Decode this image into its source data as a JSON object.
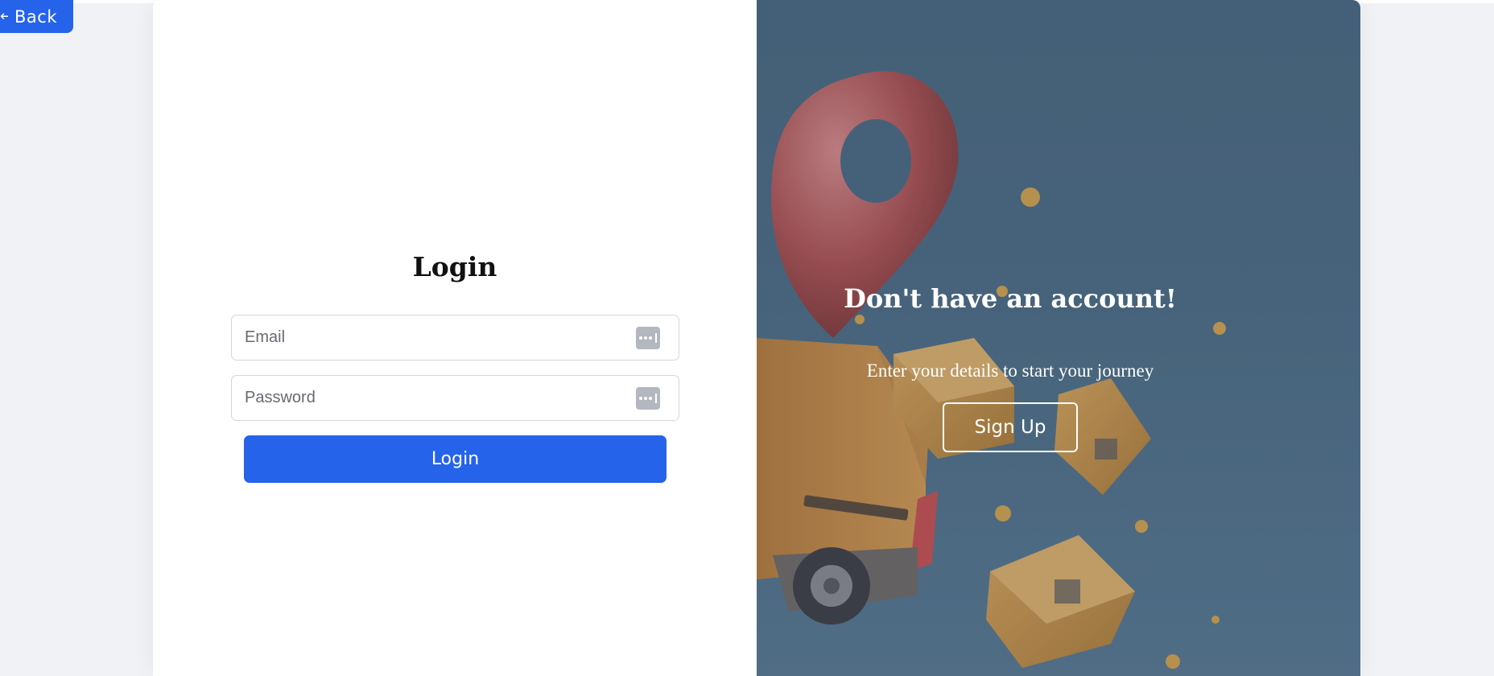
{
  "nav": {
    "back_label": "Back",
    "back_icon": "arrow-left-icon"
  },
  "login": {
    "title": "Login",
    "email_placeholder": "Email",
    "password_placeholder": "Password",
    "field_icon": "password-manager-icon",
    "submit_label": "Login"
  },
  "signup_panel": {
    "title": "Don't have an account!",
    "subtitle": "Enter your details to start your journey",
    "button_label": "Sign Up"
  },
  "colors": {
    "accent": "#2563eb",
    "panel_background": "#4d6c84",
    "page_background": "#f0f2f5"
  }
}
